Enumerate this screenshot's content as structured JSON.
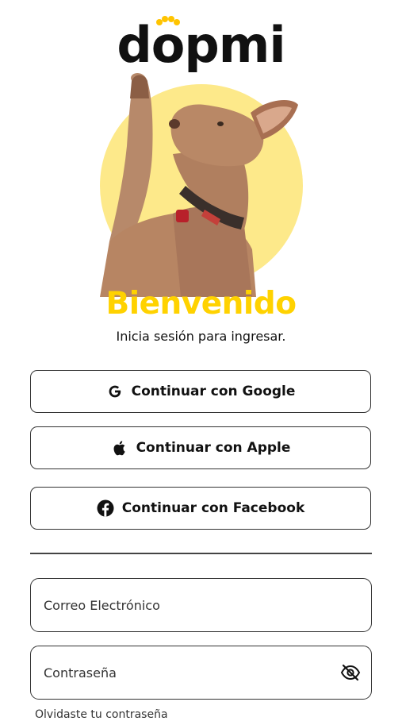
{
  "brand": {
    "logo_d": "d",
    "logo_o": "o",
    "logo_rest": "pmi",
    "accent_color": "#ffd200"
  },
  "hero": {
    "image": "dog-waving-photo",
    "circle_color": "#fde98a"
  },
  "welcome": {
    "title": "Bienvenido",
    "subtitle": "Inicia sesión para ingresar."
  },
  "social": {
    "google": {
      "label": "Continuar con Google",
      "icon": "google-icon"
    },
    "apple": {
      "label": "Continuar con Apple",
      "icon": "apple-icon"
    },
    "facebook": {
      "label": "Continuar con Facebook",
      "icon": "facebook-icon"
    }
  },
  "form": {
    "email_placeholder": "Correo Electrónico",
    "password_placeholder": "Contraseña",
    "password_toggle_icon": "eye-off-icon",
    "forgot_label": "Olvidaste tu contraseña"
  }
}
